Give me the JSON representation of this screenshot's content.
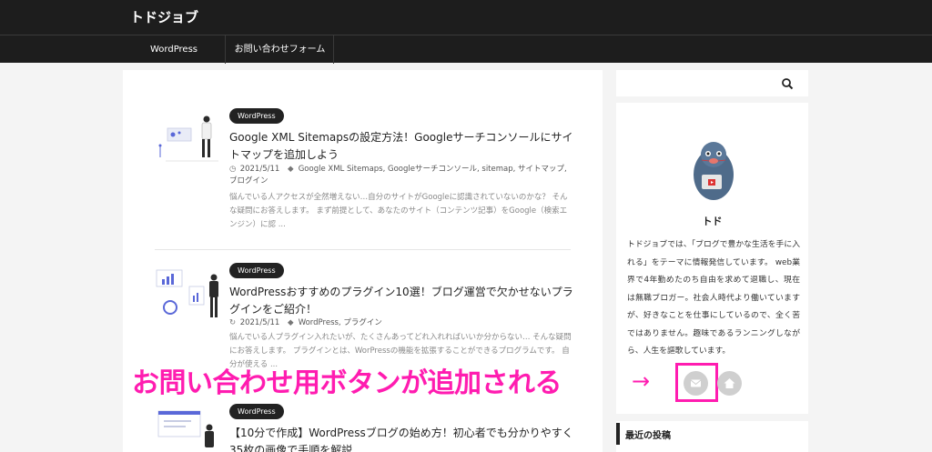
{
  "site": {
    "title": "トドジョブ"
  },
  "nav": {
    "items": [
      {
        "label": "WordPress"
      },
      {
        "label": "お問い合わせフォーム"
      }
    ]
  },
  "posts": [
    {
      "category": "WordPress",
      "title": "Google XML Sitemapsの設定方法！Googleサーチコンソールにサイトマップを追加しよう",
      "date": "2021/5/11",
      "tags": "Google XML Sitemaps, Googleサーチコンソール, sitemap, サイトマップ, ブログイン",
      "excerpt": "悩んでいる人アクセスが全然増えない…自分のサイトがGoogleに認識されていないのかな？ そんな疑問にお答えします。 まず前提として、あなたのサイト（コンテンツ記事）をGoogle（検索エンジン）に認 ..."
    },
    {
      "category": "WordPress",
      "title": "WordPressおすすめのプラグイン10選！ブログ運営で欠かせないプラグインをご紹介！",
      "date": "2021/5/11",
      "tags": "WordPress, プラグイン",
      "excerpt": "悩んでいる人プラグイン入れたいが、たくさんあってどれ入れればいいか分からない… そんな疑問にお答えします。 プラグインとは、WorPressの機能を拡張することができるプログラムです。 自分が使える ..."
    },
    {
      "category": "WordPress",
      "title": "【10分で作成】WordPressブログの始め方！初心者でも分かりやすく35枚の画像で手順を解説",
      "date": "",
      "tags": "",
      "excerpt": ""
    }
  ],
  "search": {
    "placeholder": ""
  },
  "profile": {
    "name": "トド",
    "bio": "トドジョブでは、「ブログで豊かな生活を手に入れる」をテーマに情報発信しています。 web業界で4年勤めたのち自由を求めて退職し、現在は無職ブロガー。社会人時代より働いていますが、好きなことを仕事にしているので、全く苦ではありません。趣味であるランニングしながら、人生を謳歌しています。"
  },
  "annotation": {
    "callout": "お問い合わせ用ボタンが追加される",
    "arrow": "→"
  },
  "sidebar": {
    "recent_title": "最近の投稿"
  },
  "icons": {
    "mail": "mail-icon",
    "home": "home-icon",
    "search": "search-icon",
    "clock": "clock-icon",
    "refresh": "refresh-icon",
    "tag": "tag-icon"
  },
  "colors": {
    "header": "#1d1d1d",
    "accent": "#ff1cb0",
    "pill": "#222222"
  }
}
